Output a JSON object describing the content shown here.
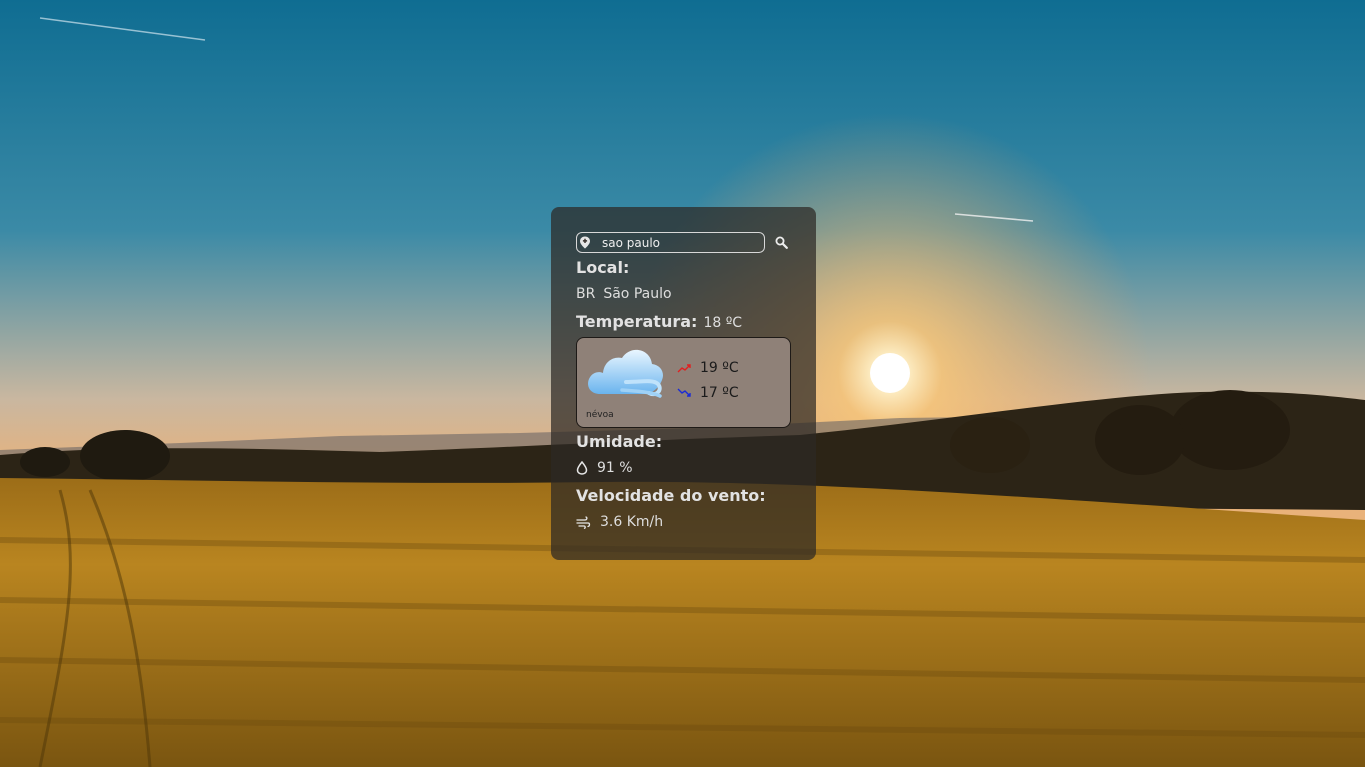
{
  "search": {
    "value": "sao paulo",
    "icon": "search-icon",
    "location_icon": "location-pin-icon"
  },
  "location": {
    "label": "Local:",
    "country": "BR",
    "city": "São Paulo"
  },
  "temperature": {
    "label": "Temperatura:",
    "value": "18 ºC"
  },
  "forecast": {
    "icon": "cloud-wind-icon",
    "description": "névoa",
    "max": "19 ºC",
    "min": "17 ºC",
    "max_color": "#e02020",
    "min_color": "#1a2bd6"
  },
  "humidity": {
    "label": "Umidade:",
    "value": "91 %",
    "icon": "droplet-icon"
  },
  "wind": {
    "label": "Velocidade do vento:",
    "value": "3.6 Km/h",
    "icon": "wind-icon"
  }
}
